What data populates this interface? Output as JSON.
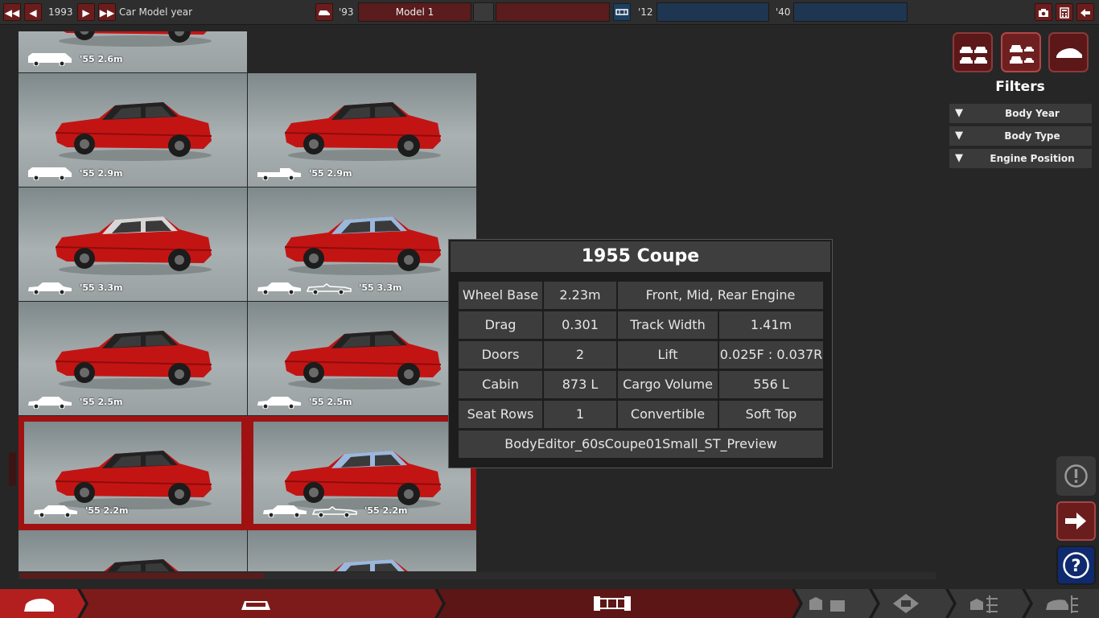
{
  "topbar": {
    "year_value": "1993",
    "year_label": "Car Model year",
    "model_year_short": "'93",
    "model_name": "Model 1",
    "trim_name": "",
    "chassis_year_short": "'12",
    "chassis_name": "",
    "engine_year_short": "'40",
    "engine_name": ""
  },
  "grid": {
    "cells": [
      {
        "year": "'55",
        "length": "2.6m",
        "icons": [
          "wagon-icon"
        ],
        "roof": "#9e1010"
      },
      {
        "year": "'55",
        "length": "2.9m",
        "icons": [
          "wagon-icon"
        ],
        "roof": "#222222"
      },
      {
        "year": "'55",
        "length": "2.9m",
        "icons": [
          "pickup-icon"
        ],
        "roof": "#222222"
      },
      {
        "year": "'55",
        "length": "3.3m",
        "icons": [
          "sedan-icon"
        ],
        "roof": "#d7d7d7"
      },
      {
        "year": "'55",
        "length": "3.3m",
        "icons": [
          "sedan-icon",
          "convertible-icon"
        ],
        "roof": "#9ab8dc"
      },
      {
        "year": "'55",
        "length": "2.5m",
        "icons": [
          "sedan-icon"
        ],
        "roof": "#222222"
      },
      {
        "year": "'55",
        "length": "2.5m",
        "icons": [
          "sedan-icon"
        ],
        "roof": "#222222"
      },
      {
        "year": "'55",
        "length": "2.2m",
        "icons": [
          "coupe-icon"
        ],
        "roof": "#222222"
      },
      {
        "year": "'55",
        "length": "2.2m",
        "icons": [
          "coupe-icon",
          "convertible-icon"
        ],
        "roof": "#9ab8dc"
      },
      {
        "year": "",
        "length": "",
        "icons": [],
        "roof": "#222222"
      },
      {
        "year": "",
        "length": "",
        "icons": [],
        "roof": "#9ab8dc"
      }
    ]
  },
  "info": {
    "title": "1955 Coupe",
    "wheel_base_label": "Wheel Base",
    "wheel_base_value": "2.23m",
    "engine_positions": "Front, Mid,  Rear Engine",
    "drag_label": "Drag",
    "drag_value": "0.301",
    "track_width_label": "Track Width",
    "track_width_value": "1.41m",
    "doors_label": "Doors",
    "doors_value": "2",
    "lift_label": "Lift",
    "lift_value": "0.025F : 0.037R",
    "cabin_label": "Cabin",
    "cabin_value": "873 L",
    "cargo_label": "Cargo Volume",
    "cargo_value": "556 L",
    "seat_rows_label": "Seat Rows",
    "seat_rows_value": "1",
    "convertible_label": "Convertible",
    "convertible_value": "Soft Top",
    "asset_name": "BodyEditor_60sCoupe01Small_ST_Preview"
  },
  "filters": {
    "title": "Filters",
    "items": [
      "Body Year",
      "Body Type",
      "Engine Position"
    ]
  },
  "colors": {
    "accent_red": "#6b1d1d",
    "selected_red": "#a01212",
    "help_blue": "#0f2a6e",
    "car_red": "#c31414"
  }
}
